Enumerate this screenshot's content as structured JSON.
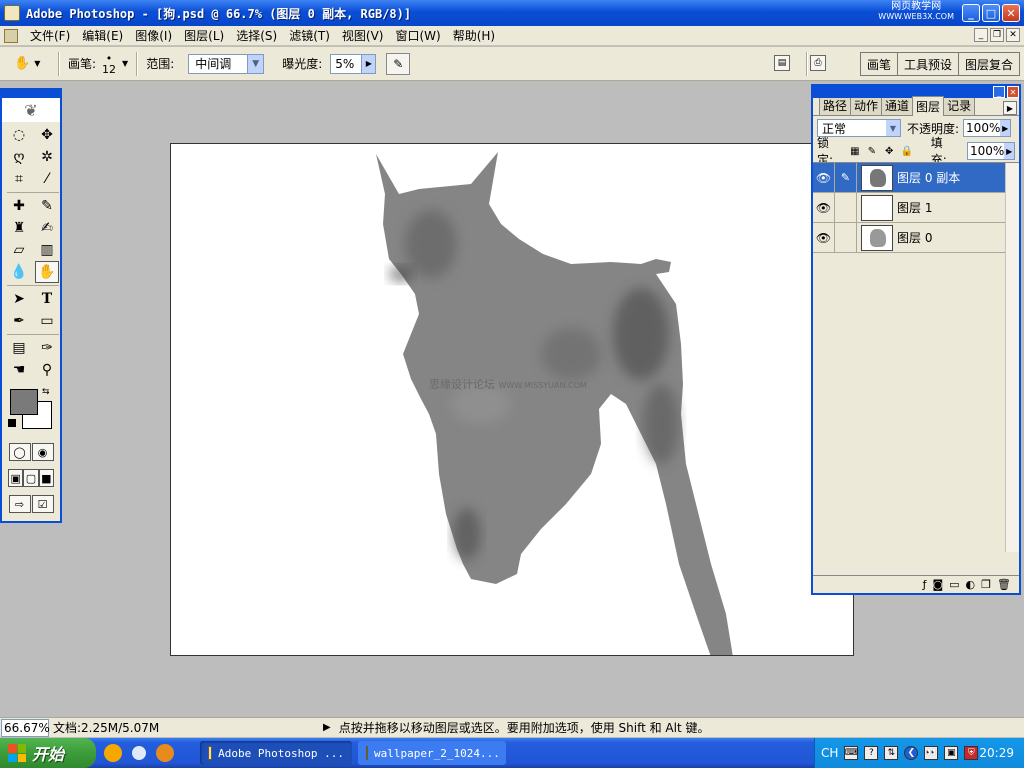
{
  "window": {
    "title": "Adobe Photoshop - [狗.psd @ 66.7% (图层 0 副本, RGB/8)]",
    "watermark": "网页教学网",
    "watermark_sub": "WWW.WEB3X.COM"
  },
  "menu": [
    "文件(F)",
    "编辑(E)",
    "图像(I)",
    "图层(L)",
    "选择(S)",
    "滤镜(T)",
    "视图(V)",
    "窗口(W)",
    "帮助(H)"
  ],
  "options": {
    "brush_label": "画笔:",
    "brush_size": "12",
    "range_label": "范围:",
    "range_value": "中间调",
    "exposure_label": "曝光度:",
    "exposure_value": "5%",
    "palette_well_tabs": [
      "画笔",
      "工具预设",
      "图层复合"
    ]
  },
  "toolbox": {
    "tools": [
      "marquee-icon",
      "move-icon",
      "lasso-icon",
      "magic-wand-icon",
      "crop-icon",
      "slice-icon",
      "healing-brush-icon",
      "brush-icon",
      "clone-stamp-icon",
      "history-brush-icon",
      "eraser-icon",
      "gradient-icon",
      "blur-icon",
      "burn-icon",
      "path-selection-icon",
      "type-icon",
      "pen-icon",
      "shape-icon",
      "notes-icon",
      "eyedropper-icon",
      "hand-icon",
      "zoom-icon"
    ],
    "active_tool": "burn-icon",
    "foreground_color": "#7a7a7a",
    "background_color": "#ffffff"
  },
  "canvas": {
    "watermark": "思缘设计论坛",
    "watermark_url": "WWW.MISSYUAN.COM"
  },
  "layers_panel": {
    "tabs": [
      "路径",
      "动作",
      "通道",
      "图层",
      "记录"
    ],
    "active_tab": "图层",
    "blend_mode": "正常",
    "opacity_label": "不透明度:",
    "opacity_value": "100%",
    "lock_label": "锁定:",
    "fill_label": "填充:",
    "fill_value": "100%",
    "layers": [
      {
        "name": "图层 0 副本",
        "selected": true
      },
      {
        "name": "图层 1",
        "selected": false
      },
      {
        "name": "图层 0",
        "selected": false
      }
    ]
  },
  "status": {
    "zoom": "66.67%",
    "doc_info": "文档:2.25M/5.07M",
    "hint": "点按并拖移以移动图层或选区。要用附加选项，使用 Shift 和 Alt 键。"
  },
  "taskbar": {
    "start_label": "开始",
    "tasks": [
      {
        "label": "Adobe Photoshop ...",
        "active": true
      },
      {
        "label": "wallpaper_2_1024...",
        "active": false
      }
    ],
    "language": "CH",
    "clock": "20:29"
  },
  "colors": {
    "xp_blue": "#0a4ed6",
    "selection": "#316ac5",
    "chrome": "#ece9d8"
  }
}
